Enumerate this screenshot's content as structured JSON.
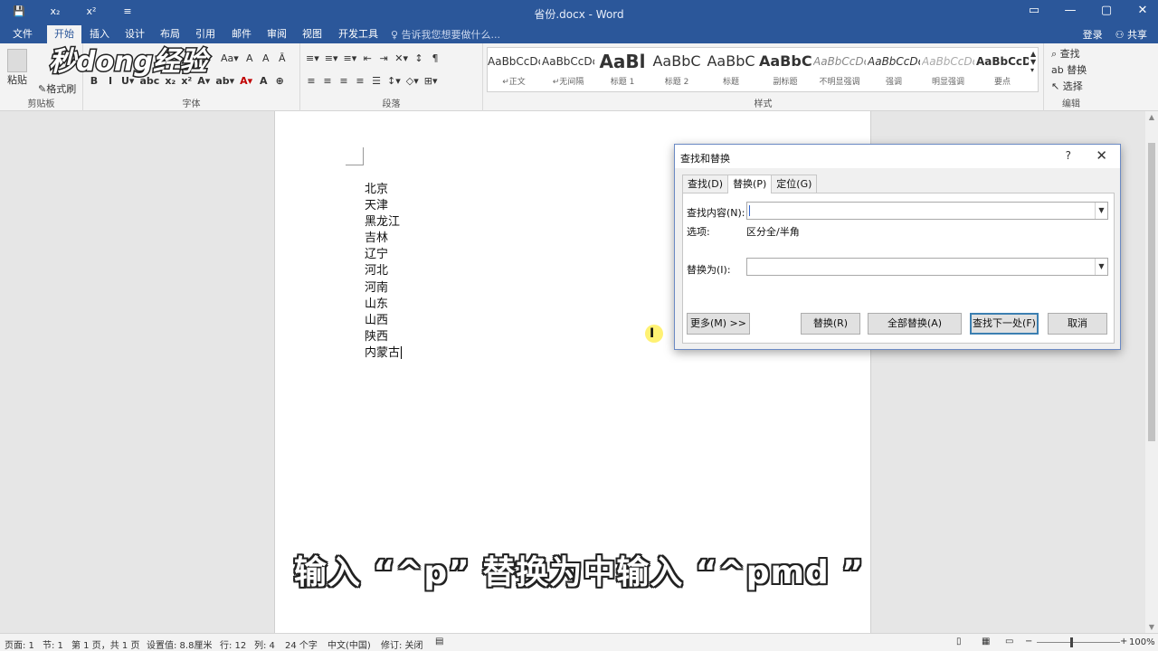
{
  "window": {
    "title": "省份.docx - Word",
    "qat": [
      "💾",
      "x₂",
      "x²",
      "≡"
    ],
    "controls": [
      "▭",
      "—",
      "▢",
      "✕"
    ]
  },
  "tabs": {
    "items": [
      "文件",
      "开始",
      "插入",
      "设计",
      "布局",
      "引用",
      "邮件",
      "审阅",
      "视图",
      "开发工具"
    ],
    "active": "开始",
    "tellme": "告诉我您想要做什么...",
    "login": "登录",
    "share": "共享"
  },
  "ribbon": {
    "clipboard": {
      "paste": "粘贴",
      "format_painter": "格式刷",
      "label": "剪贴板"
    },
    "font": {
      "label": "字体",
      "row1": [
        "Aa▾",
        "A",
        "A",
        "Ā"
      ],
      "row2": [
        "B",
        "I",
        "U▾",
        "abc",
        "x₂",
        "x²",
        "A▾",
        "ab▾",
        "A▾",
        "A",
        "⊕"
      ]
    },
    "paragraph": {
      "label": "段落",
      "row1": [
        "≡▾",
        "≡▾",
        "≡▾",
        "⇤",
        "⇥",
        "✕▾",
        "↕",
        "¶"
      ],
      "row2": [
        "≡",
        "≡",
        "≡",
        "≡",
        "☰",
        "↕▾",
        "◇▾",
        "⊞▾"
      ]
    },
    "styles": {
      "label": "样式",
      "items": [
        {
          "preview": "AaBbCcDc",
          "name": "↵正文"
        },
        {
          "preview": "AaBbCcDc",
          "name": "↵无间隔"
        },
        {
          "preview": "AaBl",
          "name": "标题 1"
        },
        {
          "preview": "AaBbC",
          "name": "标题 2"
        },
        {
          "preview": "AaBbC",
          "name": "标题"
        },
        {
          "preview": "AaBbC",
          "name": "副标题"
        },
        {
          "preview": "AaBbCcDe",
          "name": "不明显强调"
        },
        {
          "preview": "AaBbCcDe",
          "name": "强调"
        },
        {
          "preview": "AaBbCcDe",
          "name": "明显强调"
        },
        {
          "preview": "AaBbCcD",
          "name": "要点"
        }
      ]
    },
    "editing": {
      "label": "编辑",
      "find": "查找",
      "replace": "替换",
      "select": "选择"
    }
  },
  "watermark": "秒dong经验",
  "document": {
    "lines": [
      "北京",
      "天津",
      "黑龙江",
      "吉林",
      "辽宁",
      "河北",
      "河南",
      "山东",
      "山西",
      "陕西",
      "内蒙古"
    ]
  },
  "subtitle": "输入 “^p” 替换为中输入 “^pmd ”",
  "dialog": {
    "title": "查找和替换",
    "help": "?",
    "close": "✕",
    "tabs": [
      "查找(D)",
      "替换(P)",
      "定位(G)"
    ],
    "active_tab": "替换(P)",
    "find_label": "查找内容(N):",
    "find_value": "",
    "options_label": "选项:",
    "options_value": "区分全/半角",
    "replace_label": "替换为(I):",
    "replace_value": "",
    "buttons": {
      "more": "更多(M) >>",
      "replace": "替换(R)",
      "replace_all": "全部替换(A)",
      "find_next": "查找下一处(F)",
      "cancel": "取消"
    }
  },
  "statusbar": {
    "items": [
      "页面: 1",
      "节: 1",
      "第 1 页，共 1 页",
      "设置值: 8.8厘米",
      "行: 12",
      "列: 4",
      "24 个字",
      "中文(中国)",
      "修订: 关闭"
    ],
    "zoom": "100%"
  }
}
